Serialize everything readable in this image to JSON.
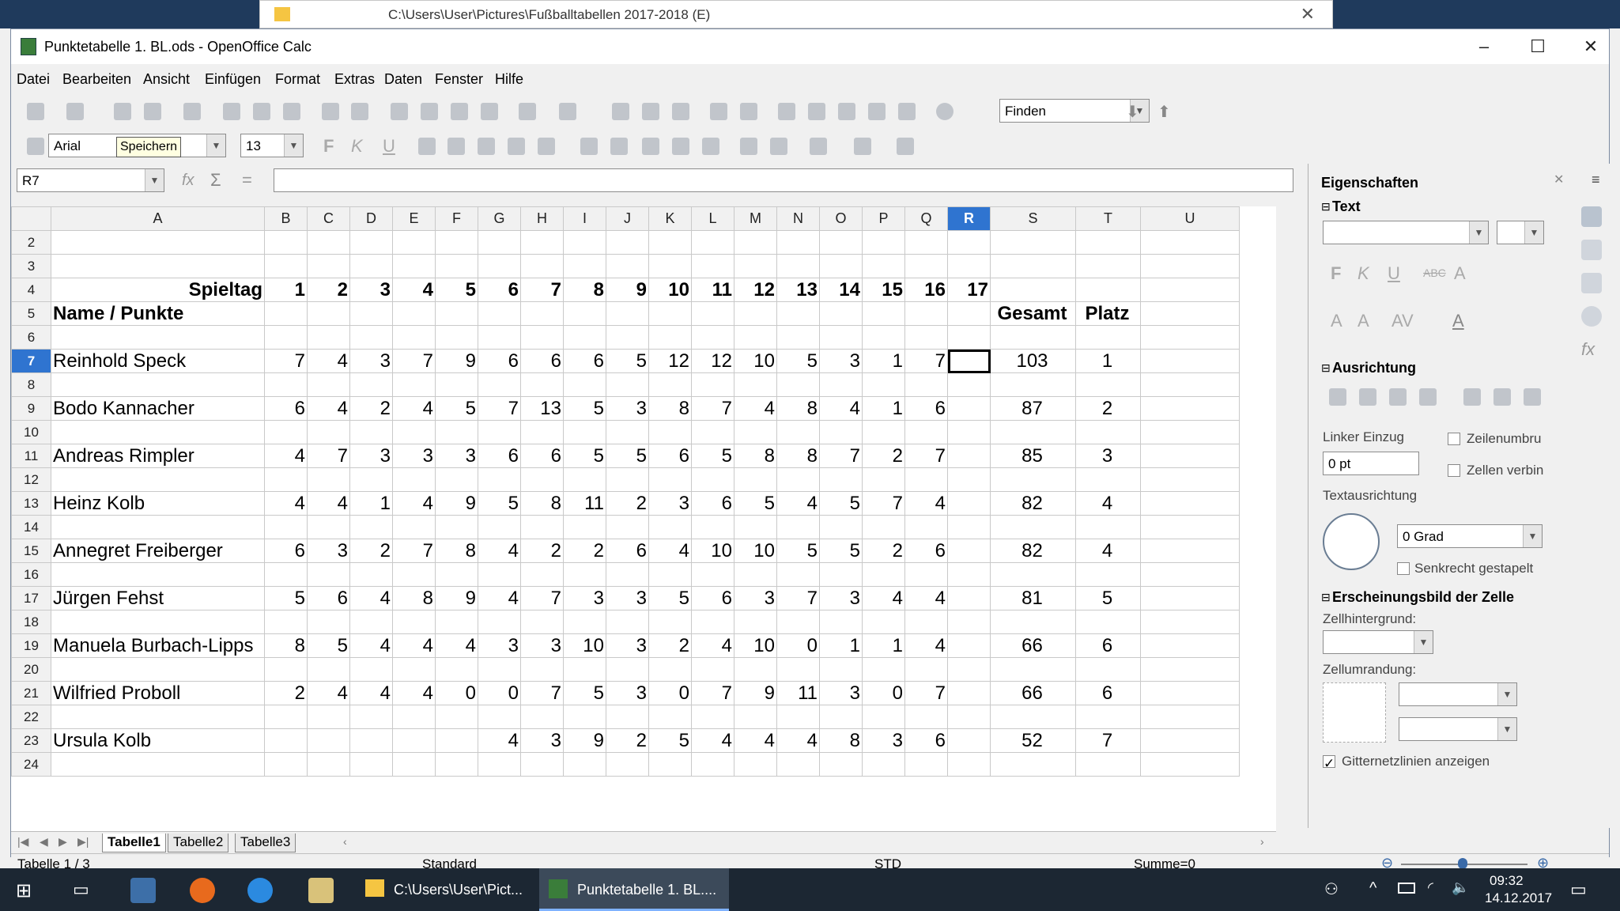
{
  "explorer": {
    "path": "C:\\Users\\User\\Pictures\\Fußballtabellen 2017-2018 (E)"
  },
  "window": {
    "title": "Punktetabelle 1. BL.ods - OpenOffice Calc"
  },
  "menu": [
    "Datei",
    "Bearbeiten",
    "Ansicht",
    "Einfügen",
    "Format",
    "Extras",
    "Daten",
    "Fenster",
    "Hilfe"
  ],
  "toolbar": {
    "find_placeholder": "Finden",
    "font_name": "Arial",
    "font_size": "13",
    "tooltip": "Speichern"
  },
  "formula": {
    "cell_ref": "R7",
    "content": ""
  },
  "columns": [
    "A",
    "B",
    "C",
    "D",
    "E",
    "F",
    "G",
    "H",
    "I",
    "J",
    "K",
    "L",
    "M",
    "N",
    "O",
    "P",
    "Q",
    "R",
    "S",
    "T",
    "U"
  ],
  "selected_column": "R",
  "selected_row": "7",
  "header": {
    "spieltag_label": "Spieltag",
    "matchdays": [
      "1",
      "2",
      "3",
      "4",
      "5",
      "6",
      "7",
      "8",
      "9",
      "10",
      "11",
      "12",
      "13",
      "14",
      "15",
      "16",
      "17"
    ],
    "name_label": "Name / Punkte",
    "total_label": "Gesamt",
    "rank_label": "Platz"
  },
  "players": [
    {
      "row": "7",
      "name": "Reinhold Speck",
      "points": [
        "7",
        "4",
        "3",
        "7",
        "9",
        "6",
        "6",
        "6",
        "5",
        "12",
        "12",
        "10",
        "5",
        "3",
        "1",
        "7",
        ""
      ],
      "total": "103",
      "rank": "1"
    },
    {
      "row": "9",
      "name": "Bodo Kannacher",
      "points": [
        "6",
        "4",
        "2",
        "4",
        "5",
        "7",
        "13",
        "5",
        "3",
        "8",
        "7",
        "4",
        "8",
        "4",
        "1",
        "6",
        ""
      ],
      "total": "87",
      "rank": "2"
    },
    {
      "row": "11",
      "name": "Andreas Rimpler",
      "points": [
        "4",
        "7",
        "3",
        "3",
        "3",
        "6",
        "6",
        "5",
        "5",
        "6",
        "5",
        "8",
        "8",
        "7",
        "2",
        "7",
        ""
      ],
      "total": "85",
      "rank": "3"
    },
    {
      "row": "13",
      "name": "Heinz Kolb",
      "points": [
        "4",
        "4",
        "1",
        "4",
        "9",
        "5",
        "8",
        "11",
        "2",
        "3",
        "6",
        "5",
        "4",
        "5",
        "7",
        "4",
        ""
      ],
      "total": "82",
      "rank": "4"
    },
    {
      "row": "15",
      "name": "Annegret Freiberger",
      "points": [
        "6",
        "3",
        "2",
        "7",
        "8",
        "4",
        "2",
        "2",
        "6",
        "4",
        "10",
        "10",
        "5",
        "5",
        "2",
        "6",
        ""
      ],
      "total": "82",
      "rank": "4"
    },
    {
      "row": "17",
      "name": "Jürgen Fehst",
      "points": [
        "5",
        "6",
        "4",
        "8",
        "9",
        "4",
        "7",
        "3",
        "3",
        "5",
        "6",
        "3",
        "7",
        "3",
        "4",
        "4",
        ""
      ],
      "total": "81",
      "rank": "5"
    },
    {
      "row": "19",
      "name": "Manuela Burbach-Lipps",
      "points": [
        "8",
        "5",
        "4",
        "4",
        "4",
        "3",
        "3",
        "10",
        "3",
        "2",
        "4",
        "10",
        "0",
        "1",
        "1",
        "4",
        ""
      ],
      "total": "66",
      "rank": "6"
    },
    {
      "row": "21",
      "name": "Wilfried Proboll",
      "points": [
        "2",
        "4",
        "4",
        "4",
        "0",
        "0",
        "7",
        "5",
        "3",
        "0",
        "7",
        "9",
        "11",
        "3",
        "0",
        "7",
        ""
      ],
      "total": "66",
      "rank": "6"
    },
    {
      "row": "23",
      "name": "Ursula Kolb",
      "points": [
        "",
        "",
        "",
        "",
        "",
        "4",
        "3",
        "9",
        "2",
        "5",
        "4",
        "4",
        "4",
        "8",
        "3",
        "6",
        ""
      ],
      "total": "52",
      "rank": "7"
    }
  ],
  "sheet_tabs": [
    "Tabelle1",
    "Tabelle2",
    "Tabelle3"
  ],
  "status": {
    "sheet": "Tabelle 1 / 3",
    "style": "Standard",
    "mode": "STD",
    "sum": "Summe=0"
  },
  "sidebar": {
    "title": "Eigenschaften",
    "text_section": "Text",
    "alignment_section": "Ausrichtung",
    "indent_label": "Linker Einzug",
    "indent_value": "0 pt",
    "wrap_label": "Zeilenumbru",
    "merge_label": "Zellen verbin",
    "orientation_label": "Textausrichtung",
    "angle_value": "0 Grad",
    "stacked_label": "Senkrecht gestapelt",
    "appearance_section": "Erscheinungsbild der Zelle",
    "bg_label": "Zellhintergrund:",
    "border_label": "Zellumrandung:",
    "gridlines_label": "Gitternetzlinien anzeigen"
  },
  "taskbar": {
    "items": [
      "C:\\Users\\User\\Pict...",
      "Punktetabelle 1. BL...."
    ],
    "time": "09:32",
    "date": "14.12.2017"
  }
}
